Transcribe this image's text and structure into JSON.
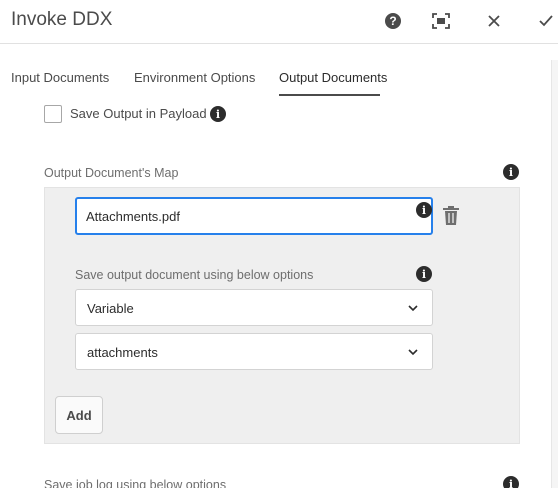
{
  "header": {
    "title": "Invoke DDX",
    "help_glyph": "?",
    "icons": [
      "help-icon",
      "fullscreen-icon",
      "close-icon",
      "checkmark-icon"
    ]
  },
  "tabs": [
    {
      "label": "Input Documents",
      "active": false
    },
    {
      "label": "Environment Options",
      "active": false
    },
    {
      "label": "Output Documents",
      "active": true
    }
  ],
  "save_output": {
    "label": "Save Output in Payload",
    "checked": false
  },
  "info_glyph": "i",
  "output_map": {
    "label": "Output Document's Map",
    "document_name": "Attachments.pdf",
    "save_using_label": "Save output document using below options",
    "type_select": "Variable",
    "variable_select": "attachments",
    "add_label": "Add"
  },
  "job_log": {
    "label": "Save job log using below options"
  },
  "colors": {
    "accent": "#2680eb",
    "text": "#4b4b4b",
    "panel": "#efefef"
  }
}
